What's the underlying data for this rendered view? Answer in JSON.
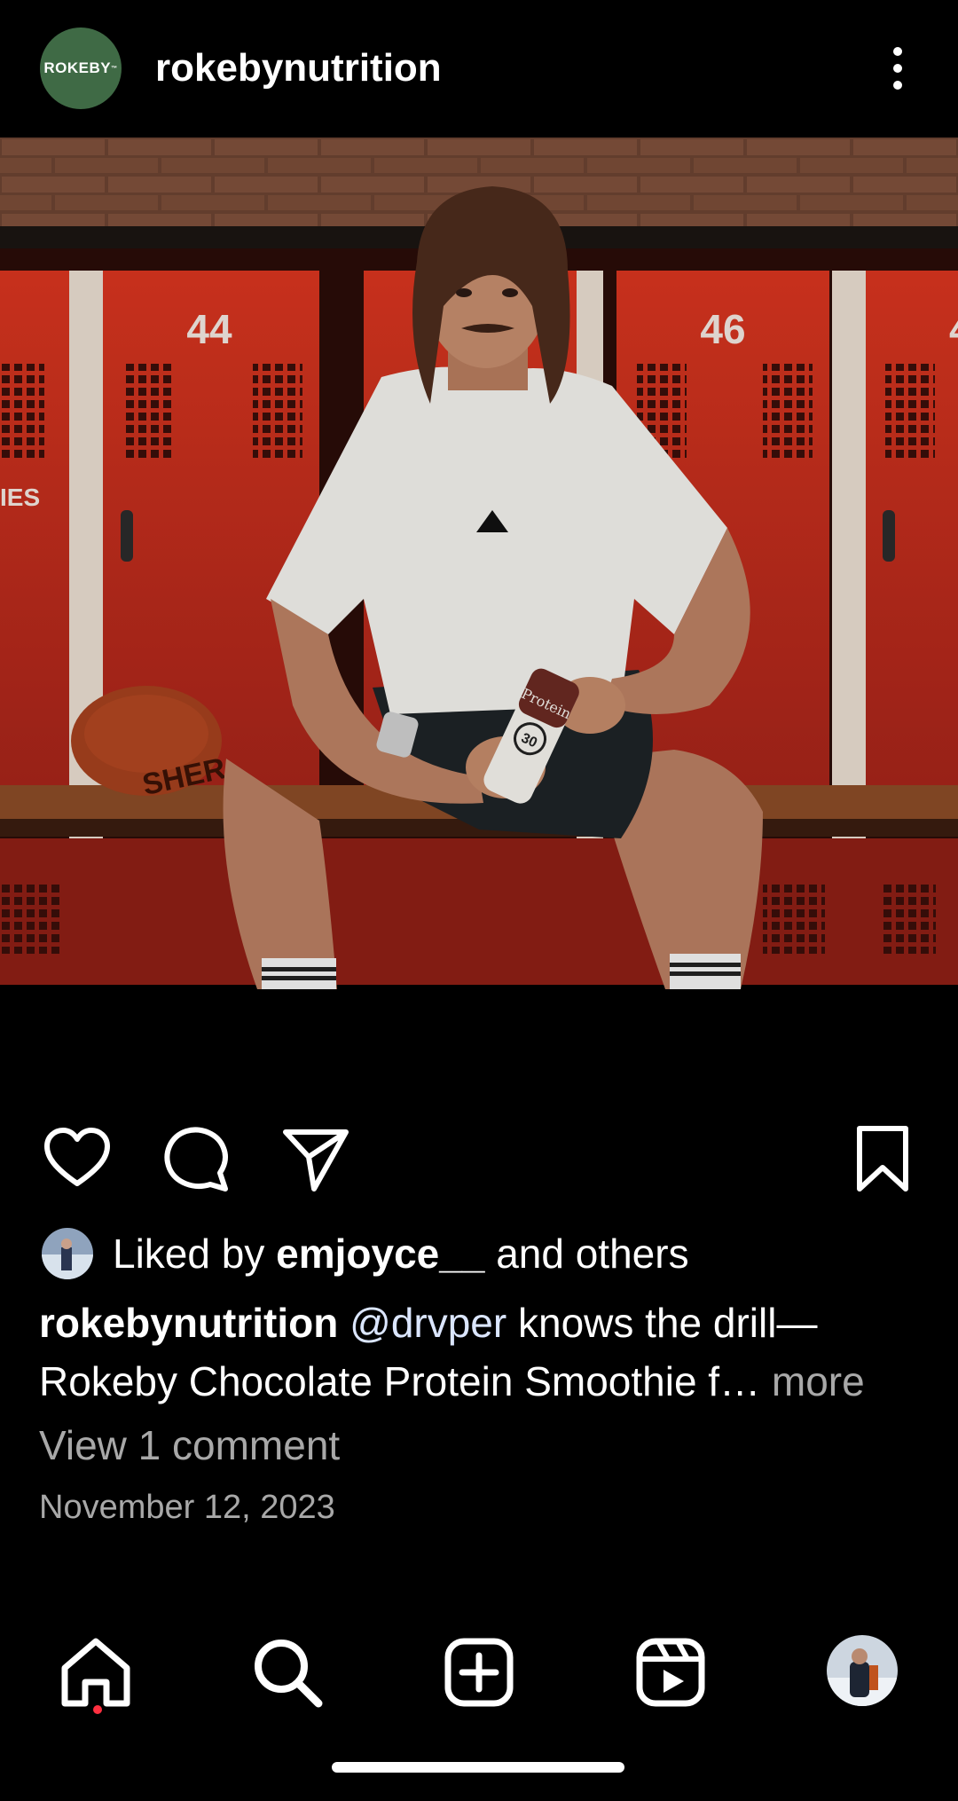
{
  "post": {
    "account": {
      "username": "rokebynutrition",
      "avatar_text": "ROKEBY",
      "avatar_mark": "™"
    },
    "image": {
      "locker_numbers": [
        "44",
        "46",
        "4"
      ],
      "locker_sign": "IES",
      "bottle_label": "Protein",
      "bottle_number": "30",
      "ball_text": "SHER"
    },
    "likes": {
      "prefix": "Liked by",
      "user": "emjoyce__",
      "suffix": "and others"
    },
    "caption": {
      "username": "rokebynutrition",
      "mention": "@drvper",
      "text": "knows the drill—",
      "text_line2": "Rokeby Chocolate Protein Smoothie f…",
      "more_label": "more"
    },
    "comments_label": "View 1 comment",
    "date": "November 12, 2023"
  },
  "icons": {
    "header": [
      "more-vertical-icon"
    ],
    "actions": [
      "heart-icon",
      "comment-icon",
      "share-icon",
      "bookmark-icon"
    ],
    "nav": [
      "home-icon",
      "search-icon",
      "create-icon",
      "reels-icon",
      "profile-avatar"
    ]
  },
  "colors": {
    "background": "#000000",
    "text": "#ffffff",
    "secondary_text": "#a8a8a8",
    "mention": "#dbe6ff",
    "brand_avatar": "#3f6a45",
    "notification_dot": "#ff3040",
    "locker_red": "#c8321e"
  }
}
